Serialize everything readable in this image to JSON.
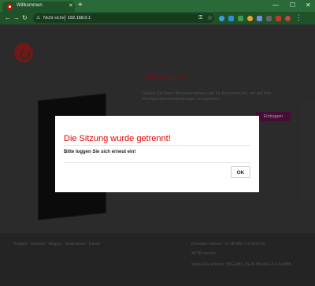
{
  "browser": {
    "tab_title": "Willkommen",
    "tab_close": "✕",
    "new_tab": "+",
    "window_controls": [
      "—",
      "☐",
      "✕"
    ],
    "nav": [
      "←",
      "→",
      "↻"
    ],
    "security_label": "Nicht sicher",
    "url": "192.168.0.1",
    "toolbar_icons": [
      "key-icon",
      "star-icon",
      "extension-icons",
      "menu-icon"
    ]
  },
  "page": {
    "welcome_title": "Willkommen",
    "welcome_text": "Geben Sie Ihren Benutzernamen und Ihr Kennwort ein, um auf Ihre Konfigurationseinstellungen zuzugreifen",
    "login_button": "Einloggen",
    "footer_languages": "English · Deutsch · Magyar · Nederlands · Dansk",
    "footer_lines": [
      "Firmware-Version: 19.3B.ABC.0.0.BG3.E8",
      "APTB-version",
      "Serial-/Fw-Version: SBG-ABC-DE-B-3B-MAS-6-0-N-8/BB"
    ],
    "brand_color": "#e60000"
  },
  "dialog": {
    "title": "Die Sitzung wurde getrennt!",
    "message": "Bitte loggen Sie sich erneut ein!",
    "ok_label": "OK"
  }
}
